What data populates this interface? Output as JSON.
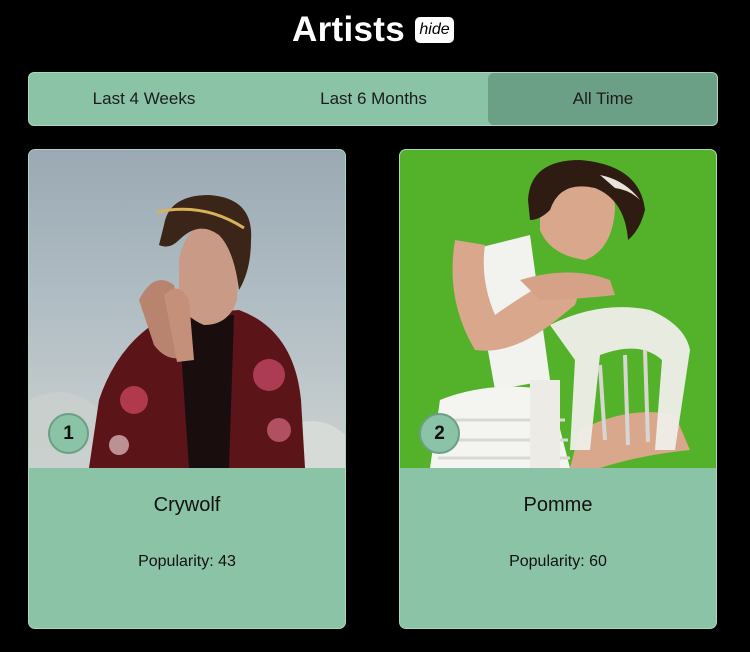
{
  "header": {
    "title": "Artists",
    "hide_label": "hide"
  },
  "tabs": [
    {
      "label": "Last 4 Weeks",
      "active": false
    },
    {
      "label": "Last 6 Months",
      "active": false
    },
    {
      "label": "All Time",
      "active": true
    }
  ],
  "artists": [
    {
      "rank": "1",
      "name": "Crywolf",
      "popularity": "Popularity: 43"
    },
    {
      "rank": "2",
      "name": "Pomme",
      "popularity": "Popularity: 60"
    }
  ],
  "colors": {
    "background": "#000000",
    "accent": "#8ac3a6",
    "active_tab": "#6b9f86",
    "photo2_bg": "#55b52c"
  }
}
